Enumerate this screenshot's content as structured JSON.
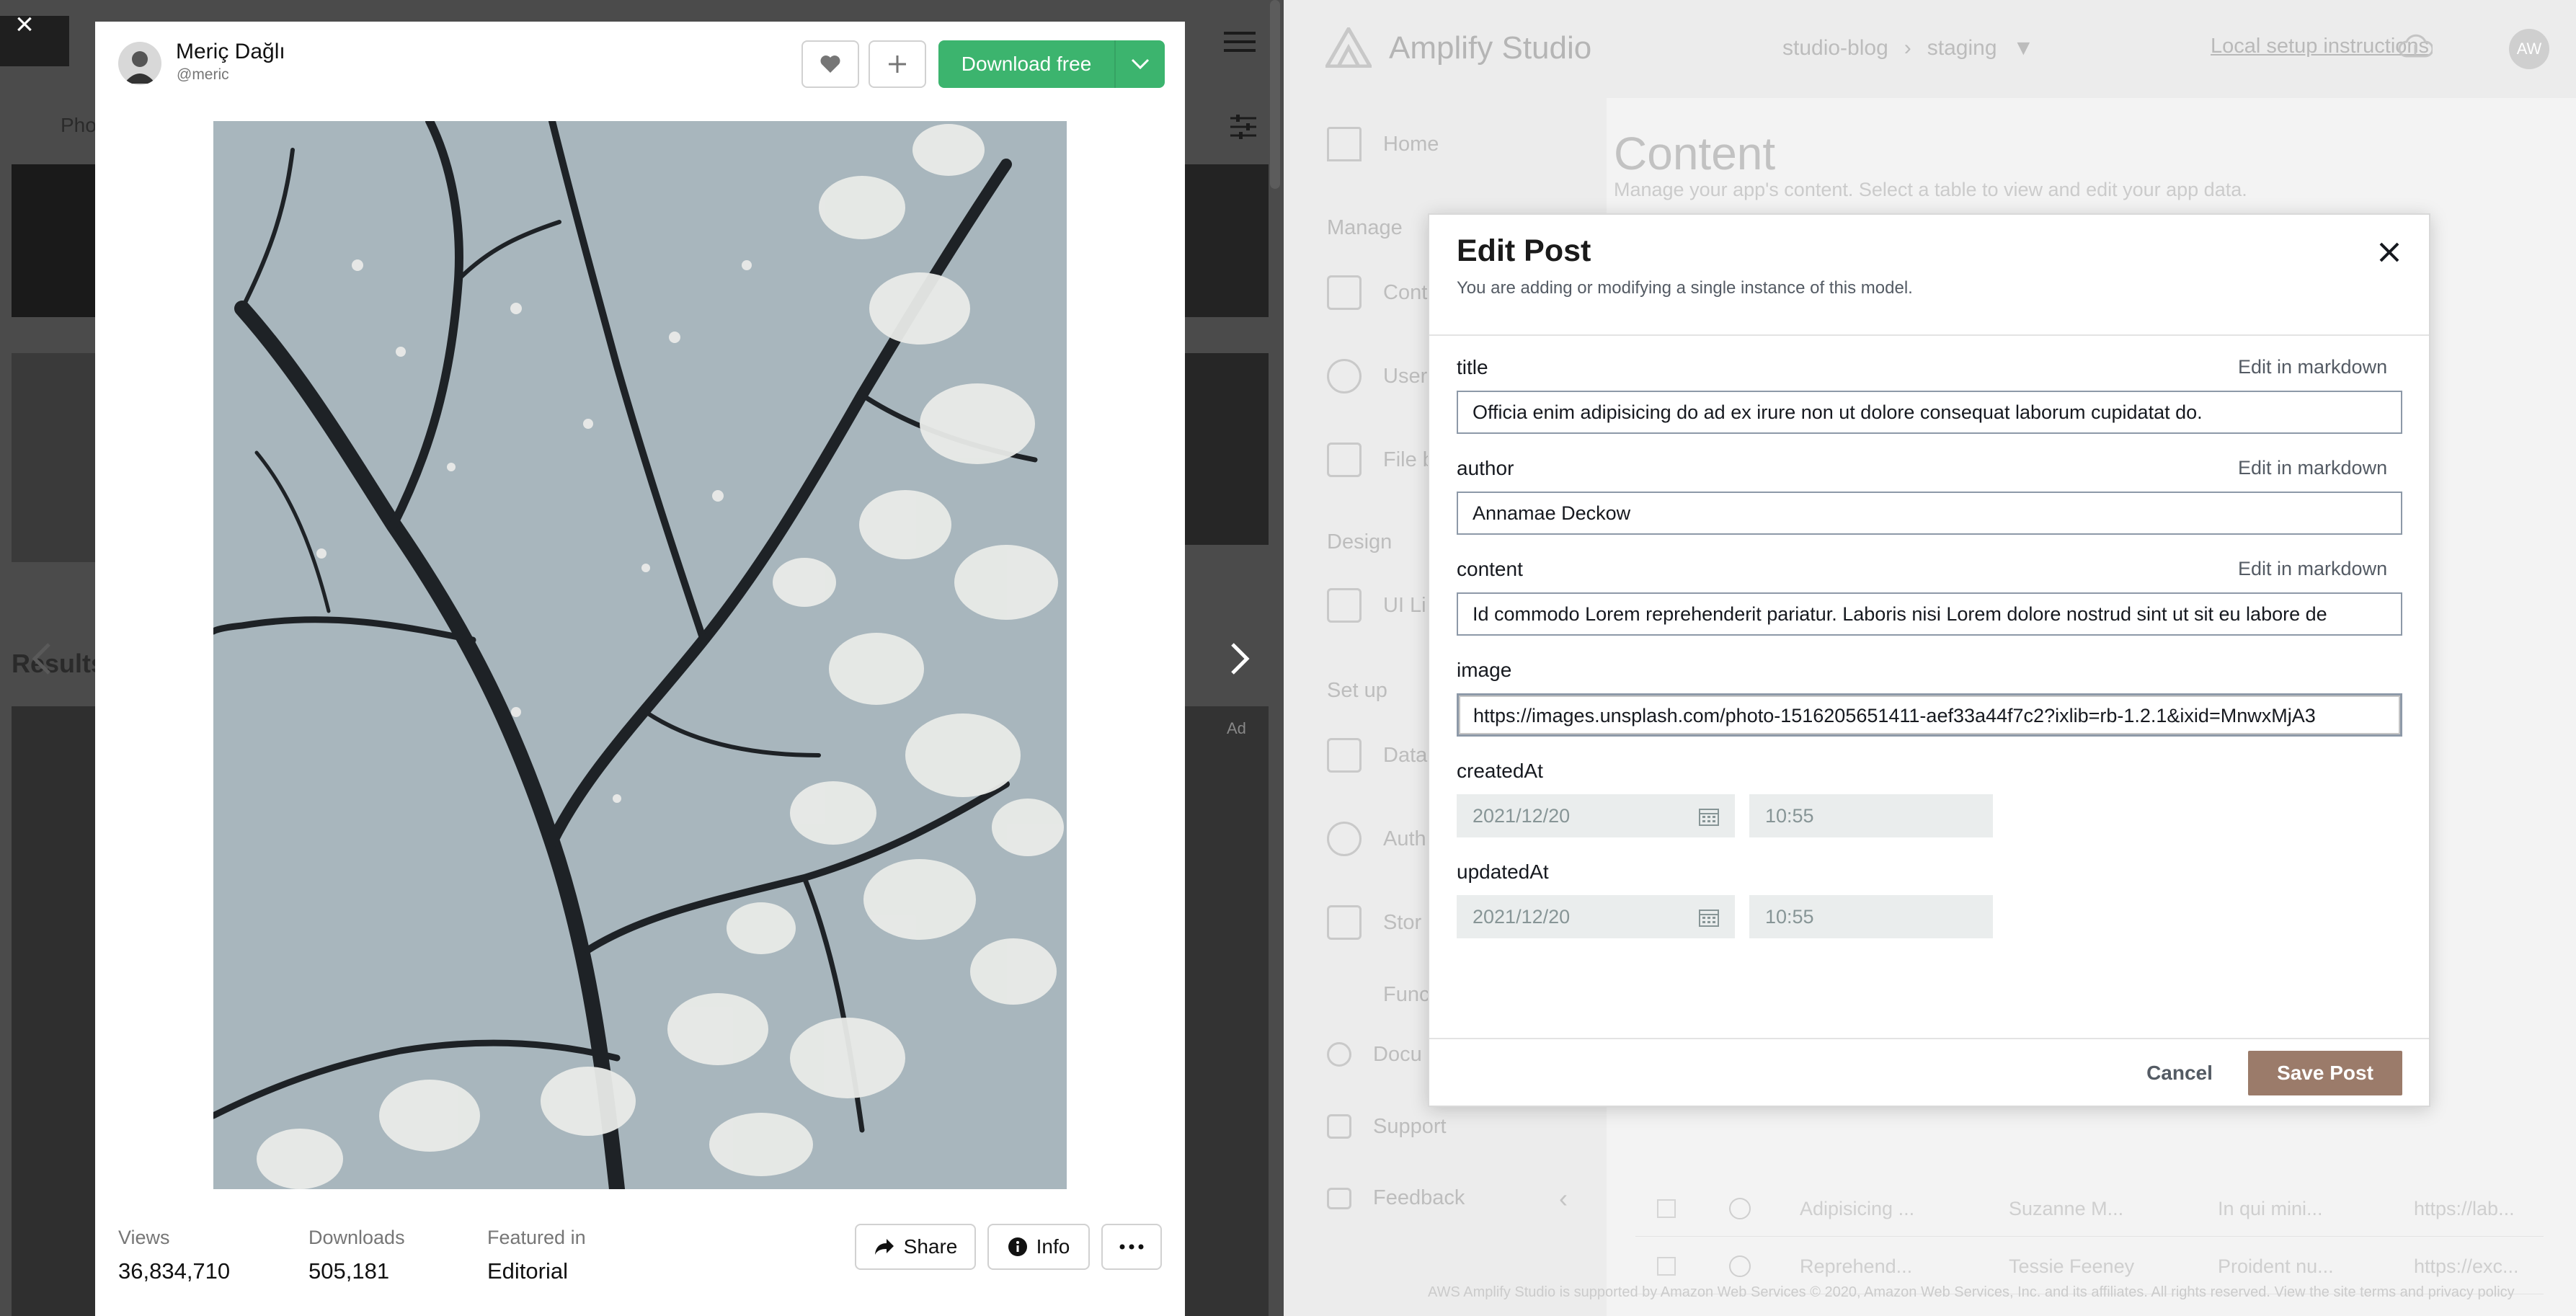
{
  "unsplash": {
    "author": {
      "name": "Meriç Dağlı",
      "handle": "@meric"
    },
    "actions": {
      "download_label": "Download free",
      "share_label": "Share",
      "info_label": "Info"
    },
    "stats": [
      {
        "label": "Views",
        "value": "36,834,710"
      },
      {
        "label": "Downloads",
        "value": "505,181"
      },
      {
        "label": "Featured in",
        "value": "Editorial"
      }
    ],
    "background": {
      "tab_label": "Pho",
      "results_label": "Results",
      "ad_label": "Ad"
    }
  },
  "amplify": {
    "app_title": "Amplify Studio",
    "breadcrumb": {
      "app": "studio-blog",
      "env": "staging"
    },
    "local_setup": "Local setup instructions",
    "avatar_initials": "AW",
    "sidebar": {
      "home": "Home",
      "manage_heading": "Manage",
      "manage_items": [
        "Cont",
        "User",
        "File b"
      ],
      "design_heading": "Design",
      "design_items": [
        "UI Li"
      ],
      "setup_heading": "Set up",
      "setup_items": [
        "Data",
        "Auth",
        "Stor",
        "Func"
      ],
      "links": [
        "Docu",
        "Support",
        "Feedback"
      ]
    },
    "main": {
      "title": "Content",
      "subtitle": "Manage your app's content. Select a table to view and edit your app data.",
      "rows": [
        [
          "Adipisicing ...",
          "Suzanne M...",
          "In qui mini...",
          "https://lab..."
        ],
        [
          "Reprehend...",
          "Tessie Feeney",
          "Proident nu...",
          "https://exc..."
        ]
      ]
    },
    "footer": "AWS Amplify Studio is supported by Amazon Web Services © 2020, Amazon Web Services, Inc. and its affiliates. All rights reserved. View the site terms and privacy policy"
  },
  "dialog": {
    "title": "Edit Post",
    "subtitle": "You are adding or modifying a single instance of this model.",
    "markdown_link": "Edit in markdown",
    "fields": {
      "title": {
        "label": "title",
        "value": "Officia enim adipisicing do ad ex irure non ut dolore consequat laborum cupidatat do."
      },
      "author": {
        "label": "author",
        "value": "Annamae Deckow"
      },
      "content": {
        "label": "content",
        "value": "Id commodo Lorem reprehenderit pariatur. Laboris nisi Lorem dolore nostrud sint ut sit eu labore de"
      },
      "image": {
        "label": "image",
        "value": "https://images.unsplash.com/photo-1516205651411-aef33a44f7c2?ixlib=rb-1.2.1&ixid=MnwxMjA3"
      },
      "createdAt": {
        "label": "createdAt",
        "date": "2021/12/20",
        "time": "10:55"
      },
      "updatedAt": {
        "label": "updatedAt",
        "date": "2021/12/20",
        "time": "10:55"
      }
    },
    "cancel_label": "Cancel",
    "save_label": "Save Post"
  }
}
